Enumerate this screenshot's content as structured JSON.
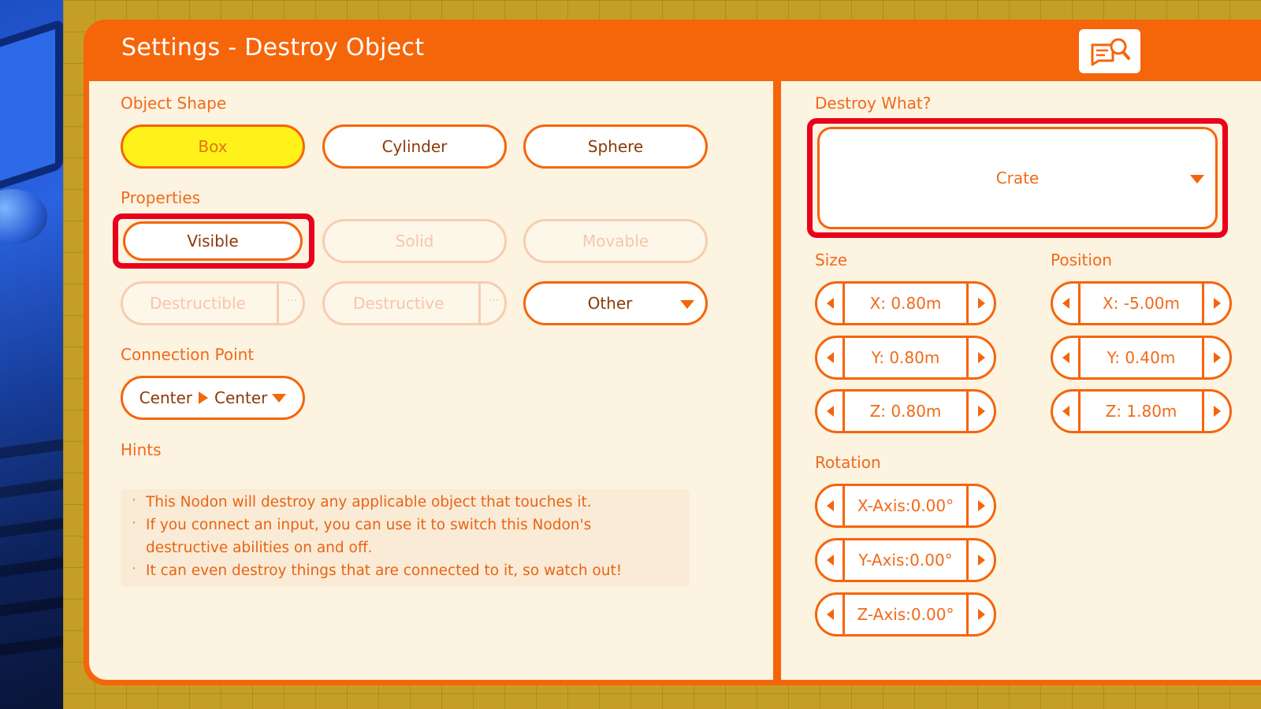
{
  "dialog": {
    "title": "Settings - Destroy Object",
    "guide_icon": "nodon-guide-icon"
  },
  "left": {
    "object_shape": {
      "label": "Object Shape",
      "options": [
        "Box",
        "Cylinder",
        "Sphere"
      ],
      "selected": "Box"
    },
    "properties": {
      "label": "Properties",
      "visible": "Visible",
      "solid": "Solid",
      "movable": "Movable",
      "destructible": "Destructible",
      "destructive": "Destructive",
      "more_glyph": "···",
      "other": "Other"
    },
    "connection_point": {
      "label": "Connection Point",
      "from": "Center",
      "to": "Center"
    },
    "hints": {
      "label": "Hints",
      "lines": [
        "This Nodon will destroy any applicable object that touches it.",
        "If you connect an input, you can use it to switch this Nodon's",
        "destructive abilities on and off.",
        "It can even destroy things that are connected to it, so watch out!"
      ]
    }
  },
  "right": {
    "destroy_what": {
      "label": "Destroy What?",
      "value": "Crate"
    },
    "size": {
      "label": "Size",
      "x": "X: 0.80m",
      "y": "Y: 0.80m",
      "z": "Z: 0.80m"
    },
    "position": {
      "label": "Position",
      "x": "X: -5.00m",
      "y": "Y: 0.40m",
      "z": "Z: 1.80m"
    },
    "rotation": {
      "label": "Rotation",
      "x": "X-Axis:0.00°",
      "y": "Y-Axis:0.00°",
      "z": "Z-Axis:0.00°"
    }
  },
  "colors": {
    "accent_orange": "#f5650a",
    "panel_cream": "#fcf3e1",
    "selected_yellow": "#fff21a",
    "highlight_red": "#e8001c"
  }
}
